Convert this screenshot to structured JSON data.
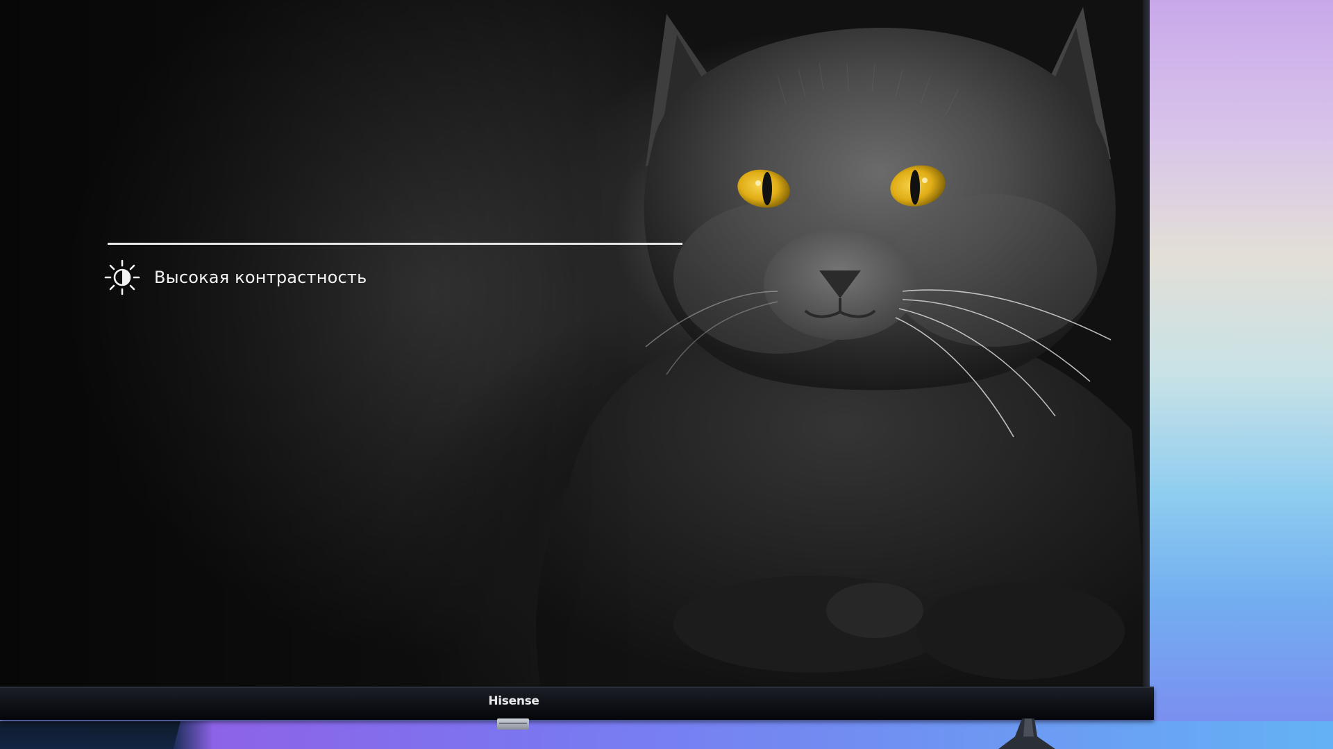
{
  "screen": {
    "feature_label": "Высокая контрастность",
    "feature_icon": "contrast-sun-icon"
  },
  "tv": {
    "brand": "Hisense"
  },
  "colors": {
    "cat_eye": "#e8b820",
    "overlay_text": "#f2f2f2",
    "background_gradient_top": "#c9a8ea",
    "background_gradient_bottom": "#7c88f0"
  }
}
